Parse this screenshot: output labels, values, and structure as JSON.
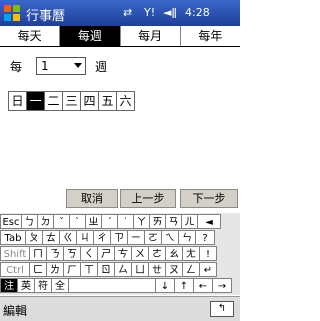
{
  "titlebar": {
    "title": "行事曆",
    "time": "4:28",
    "icons": [
      "windows-start-icon",
      "connectivity-icon",
      "signal-icon",
      "volume-icon"
    ]
  },
  "tabs": [
    {
      "label": "每天",
      "active": false
    },
    {
      "label": "每週",
      "active": true
    },
    {
      "label": "每月",
      "active": false
    },
    {
      "label": "每年",
      "active": false
    }
  ],
  "recurrence": {
    "prefix": "每",
    "value": "1",
    "suffix": "週"
  },
  "weekdays": [
    {
      "label": "日",
      "selected": false
    },
    {
      "label": "一",
      "selected": true
    },
    {
      "label": "二",
      "selected": false
    },
    {
      "label": "三",
      "selected": false
    },
    {
      "label": "四",
      "selected": false
    },
    {
      "label": "五",
      "selected": false
    },
    {
      "label": "六",
      "selected": false
    }
  ],
  "buttons": {
    "cancel": "取消",
    "prev": "上一步",
    "next": "下一步"
  },
  "keyboard": {
    "row1": [
      "Esc",
      "ㄅ",
      "ㄉ",
      "ˇ",
      "ˋ",
      "ㄓ",
      "ˊ",
      "˙",
      "ㄚ",
      "ㄞ",
      "ㄢ",
      "ㄦ",
      "◄"
    ],
    "row2": [
      "Tab",
      "ㄆ",
      "ㄊ",
      "ㄍ",
      "ㄐ",
      "ㄔ",
      "ㄗ",
      "ㄧ",
      "ㄛ",
      "ㄟ",
      "ㄣ",
      "?"
    ],
    "row3": [
      "Shift",
      "ㄇ",
      "ㄋ",
      "ㄎ",
      "ㄑ",
      "ㄕ",
      "ㄘ",
      "ㄨ",
      "ㄜ",
      "ㄠ",
      "ㄤ",
      "!"
    ],
    "row4": [
      "Ctrl",
      "ㄈ",
      "ㄌ",
      "ㄏ",
      "ㄒ",
      "ㄖ",
      "ㄙ",
      "ㄩ",
      "ㄝ",
      "ㄡ",
      "ㄥ",
      "↵"
    ],
    "row5": [
      "注",
      "英",
      "符",
      "全"
    ],
    "row5_right": [
      "↓",
      "↑",
      "←",
      "→"
    ]
  },
  "bottom": {
    "edit_label": "編輯",
    "sip_symbol": "↰"
  }
}
